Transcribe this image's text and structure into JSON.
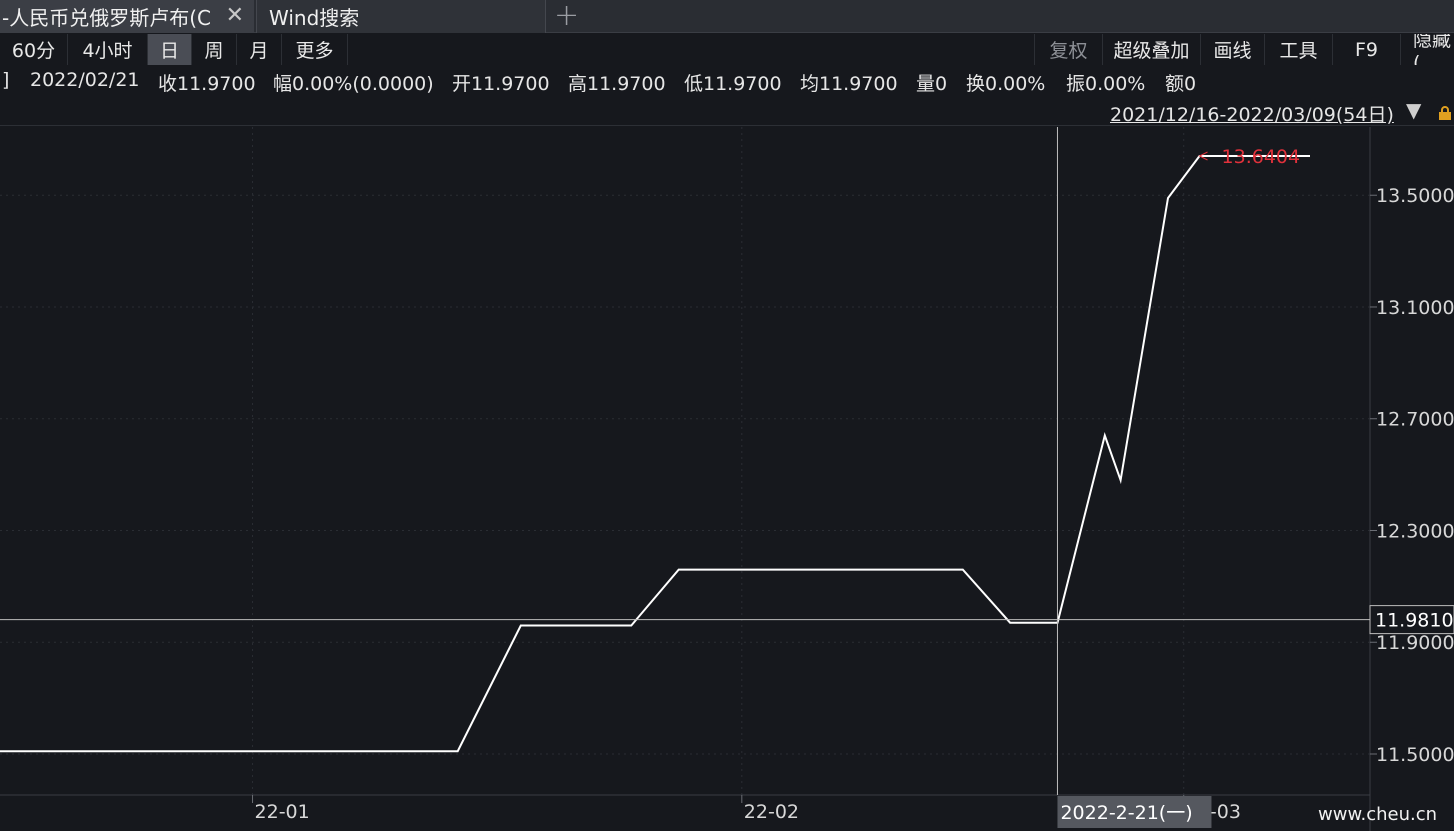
{
  "tabs": [
    {
      "label": "-人民币兑俄罗斯卢布(C",
      "close": "✕"
    },
    {
      "label": "Wind搜索"
    }
  ],
  "tab_add": "+",
  "periods": [
    "60分",
    "4小时",
    "日",
    "周",
    "月",
    "更多"
  ],
  "selected_period": "日",
  "tools": [
    "复权",
    "超级叠加",
    "画线",
    "工具",
    "F9",
    "隐藏("
  ],
  "info": {
    "bracket": "]",
    "date": "2022/02/21",
    "close": "收11.9700",
    "change": "幅0.00%(0.0000)",
    "open": "开11.9700",
    "high": "高11.9700",
    "low": "低11.9700",
    "avg": "均11.9700",
    "volume": "量0",
    "turnover": "换0.00%",
    "amplitude": "振0.00%",
    "amount": "额0"
  },
  "range": {
    "label": "2021/12/16-2022/03/09(54日)",
    "arrow": "▼"
  },
  "watermark": "www.cheu.cn",
  "colors": {
    "background": "#16181d",
    "line": "#ffffff",
    "max_label": "#e0313b",
    "crosshair": "#bdbdbd",
    "grid": "#2a2d33"
  },
  "chart_data": {
    "type": "line",
    "series": [
      {
        "values": [
          [
            "2021-12-16",
            11.51
          ],
          [
            "2022-01-14",
            11.51
          ],
          [
            "2022-01-18",
            11.96
          ],
          [
            "2022-01-25",
            11.96
          ],
          [
            "2022-01-28",
            12.16
          ],
          [
            "2022-02-15",
            12.16
          ],
          [
            "2022-02-18",
            11.97
          ],
          [
            "2022-02-21",
            11.97
          ],
          [
            "2022-02-24",
            12.64
          ],
          [
            "2022-02-25",
            12.48
          ],
          [
            "2022-02-28",
            13.49
          ],
          [
            "2022-03-02",
            13.6404
          ],
          [
            "2022-03-09",
            13.6404
          ]
        ]
      }
    ],
    "max_label": "13.6404",
    "crosshair": {
      "x_label": "2022-2-21(一)",
      "y_label": "11.9810",
      "y_value": 11.981
    },
    "ylim": [
      11.42,
      13.64
    ],
    "y_ticks": [
      "13.5000",
      "13.1000",
      "12.7000",
      "12.3000",
      "11.9000",
      "11.5000"
    ],
    "x_ticks": [
      "22-01",
      "22-02",
      "22-03"
    ]
  }
}
